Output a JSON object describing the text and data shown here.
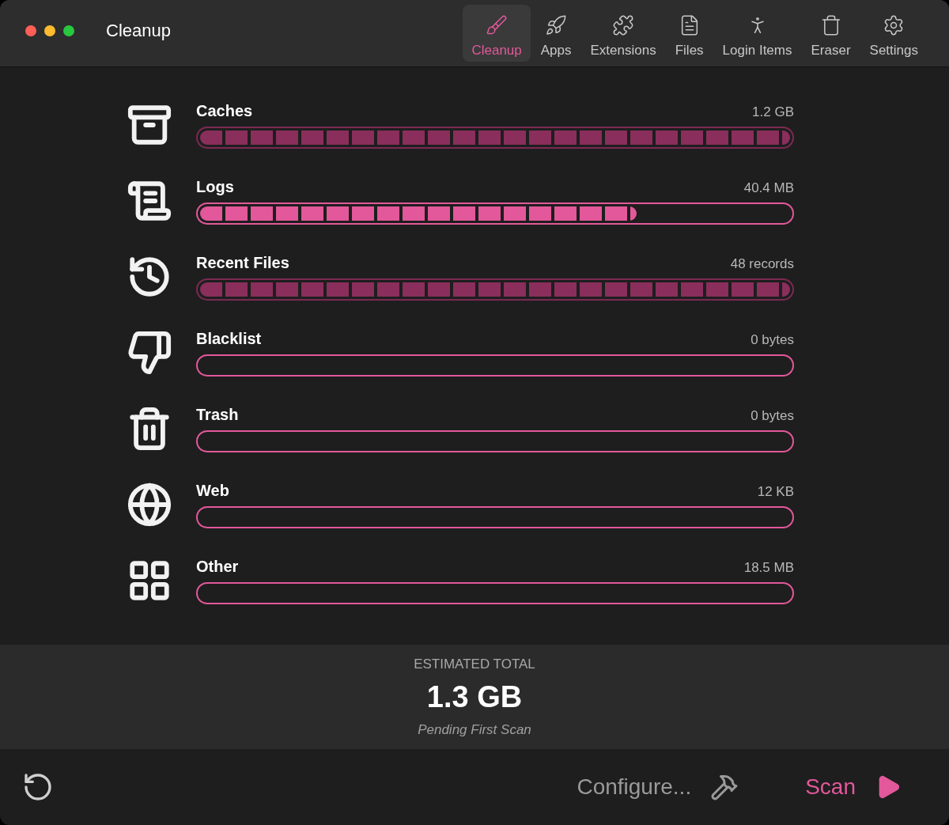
{
  "window": {
    "title": "Cleanup"
  },
  "toolbar": [
    {
      "label": "Cleanup",
      "selected": true
    },
    {
      "label": "Apps",
      "selected": false
    },
    {
      "label": "Extensions",
      "selected": false
    },
    {
      "label": "Files",
      "selected": false
    },
    {
      "label": "Login Items",
      "selected": false
    },
    {
      "label": "Eraser",
      "selected": false
    },
    {
      "label": "Settings",
      "selected": false
    }
  ],
  "categories": [
    {
      "name": "Caches",
      "size": "1.2 GB",
      "level": 1,
      "active": false
    },
    {
      "name": "Logs",
      "size": "40.4 MB",
      "level": 0.74,
      "active": true
    },
    {
      "name": "Recent Files",
      "size": "48 records",
      "level": 1,
      "active": false
    },
    {
      "name": "Blacklist",
      "size": "0 bytes",
      "active": true
    },
    {
      "name": "Trash",
      "size": "0 bytes",
      "active": true
    },
    {
      "name": "Web",
      "size": "12 KB",
      "active": true
    },
    {
      "name": "Other",
      "size": "18.5 MB",
      "active": true
    }
  ],
  "summary": {
    "label": "ESTIMATED TOTAL",
    "total": "1.3 GB",
    "status": "Pending First Scan"
  },
  "footer": {
    "configure": "Configure...",
    "scan": "Scan"
  }
}
